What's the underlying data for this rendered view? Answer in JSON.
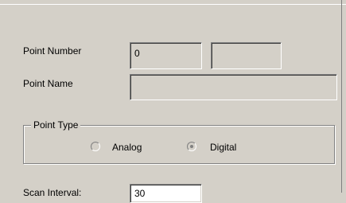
{
  "point_number": {
    "label": "Point Number",
    "value": "0",
    "secondary_value": ""
  },
  "point_name": {
    "label": "Point Name",
    "value": ""
  },
  "point_type": {
    "title": "Point Type",
    "options": [
      {
        "label": "Analog",
        "selected": false
      },
      {
        "label": "Digital",
        "selected": true
      }
    ]
  },
  "scan_interval": {
    "label": "Scan Interval:",
    "value": "30"
  }
}
